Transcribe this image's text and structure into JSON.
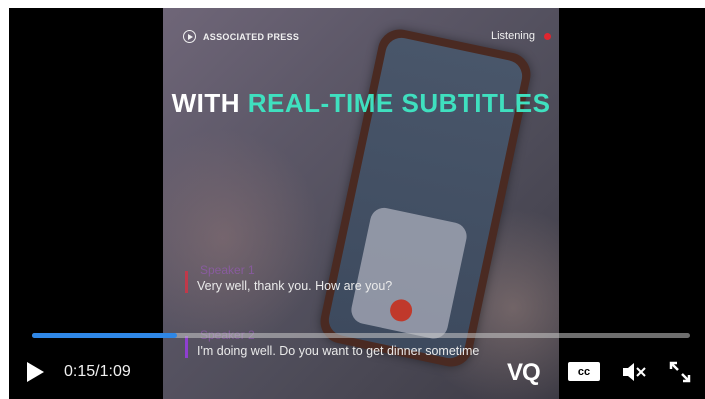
{
  "video": {
    "brand": "ASSOCIATED PRESS",
    "status": "Listening",
    "headline_white": "WITH",
    "headline_accent": "REAL-TIME SUBTITLES",
    "subtitles": [
      {
        "speaker": "Speaker 1",
        "text": "Very well, thank you. How are you?"
      },
      {
        "speaker": "Speaker 2",
        "text": "I'm doing well. Do you want to get dinner sometime"
      }
    ]
  },
  "controls": {
    "current_time": "0:15",
    "separator": "/",
    "duration": "1:09",
    "progress_fraction": 0.22,
    "vq_label": "VQ",
    "cc_label": "cc"
  },
  "colors": {
    "accent": "#3fe0bf",
    "progress": "#2f87e6",
    "rec": "#e0262f"
  }
}
